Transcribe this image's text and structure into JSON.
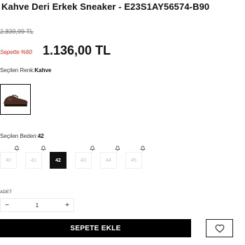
{
  "product": {
    "title": "Kahve Deri Erkek Sneaker - E23S1AY56574-B90",
    "old_price": "2.839,99 TL",
    "discount_label": "Sepette %60",
    "price": "1.136,00 TL"
  },
  "color": {
    "label": "Seçilen Renk:",
    "value": "Kahve"
  },
  "size": {
    "label": "Seçilen Beden:",
    "value": "42",
    "options": [
      {
        "label": "40",
        "selected": false,
        "notify": true
      },
      {
        "label": "41",
        "selected": false,
        "notify": true
      },
      {
        "label": "42",
        "selected": true,
        "notify": false
      },
      {
        "label": "43",
        "selected": false,
        "notify": true
      },
      {
        "label": "44",
        "selected": false,
        "notify": true
      },
      {
        "label": "45",
        "selected": false,
        "notify": true
      }
    ]
  },
  "quantity": {
    "label": "ADET",
    "minus": "−",
    "value": "1",
    "plus": "+"
  },
  "actions": {
    "add_to_cart": "SEPETE EKLE",
    "favorite_icon": "heart-icon"
  },
  "colors": {
    "discount": "#e1251b",
    "button": "#000000"
  }
}
